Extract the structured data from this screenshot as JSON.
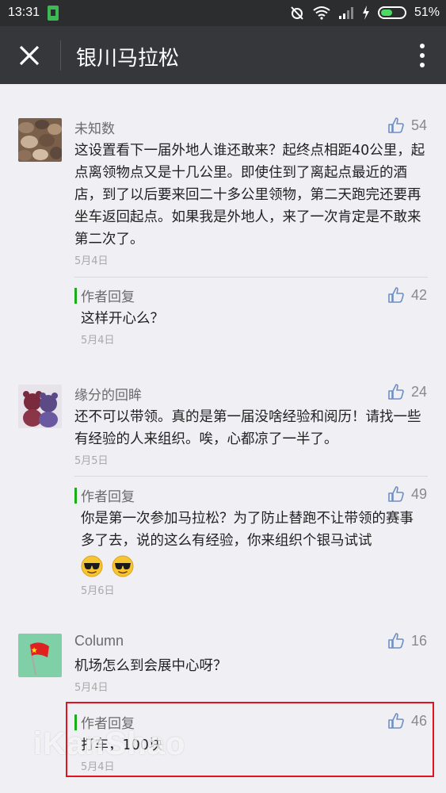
{
  "status_bar": {
    "time": "13:31",
    "battery_percent": "51%",
    "battery_level": 0.51
  },
  "app_bar": {
    "title": "银川马拉松",
    "close_icon": "close-icon",
    "more_icon": "more-vertical-icon"
  },
  "comments": [
    {
      "nick": "未知数",
      "likes": "54",
      "text": "这设置看下一届外地人谁还敢来？起终点相距40公里，起点离领物点又是十几公里。即使住到了离起点最近的酒店，到了以后要来回二十多公里领物，第二天跑完还要再坐车返回起点。如果我是外地人，来了一次肯定是不敢来第二次了。",
      "date": "5月4日",
      "reply": {
        "label": "作者回复",
        "likes": "42",
        "text": "这样开心么？",
        "date": "5月4日"
      }
    },
    {
      "nick": "缘分的回眸",
      "likes": "24",
      "text": "还不可以带领。真的是第一届没啥经验和阅历！请找一些有经验的人来组织。唉，心都凉了一半了。",
      "date": "5月5日",
      "reply": {
        "label": "作者回复",
        "likes": "49",
        "text": "你是第一次参加马拉松？为了防止替跑不让带领的赛事多了去，说的这么有经验，你来组织个银马试试",
        "emoji": [
          "cool-sunglasses-emoji",
          "cool-sunglasses-emoji"
        ],
        "date": "5月6日"
      }
    },
    {
      "nick": "Column",
      "likes": "16",
      "text": "机场怎么到会展中心呀？",
      "date": "5月4日",
      "reply": {
        "label": "作者回复",
        "likes": "46",
        "text": "打车，100块",
        "date": "5月4日"
      }
    }
  ],
  "watermark": "iKanShao",
  "colors": {
    "reply_accent": "#1aad19",
    "highlight": "#e0141e",
    "app_bar": "#36373b"
  }
}
